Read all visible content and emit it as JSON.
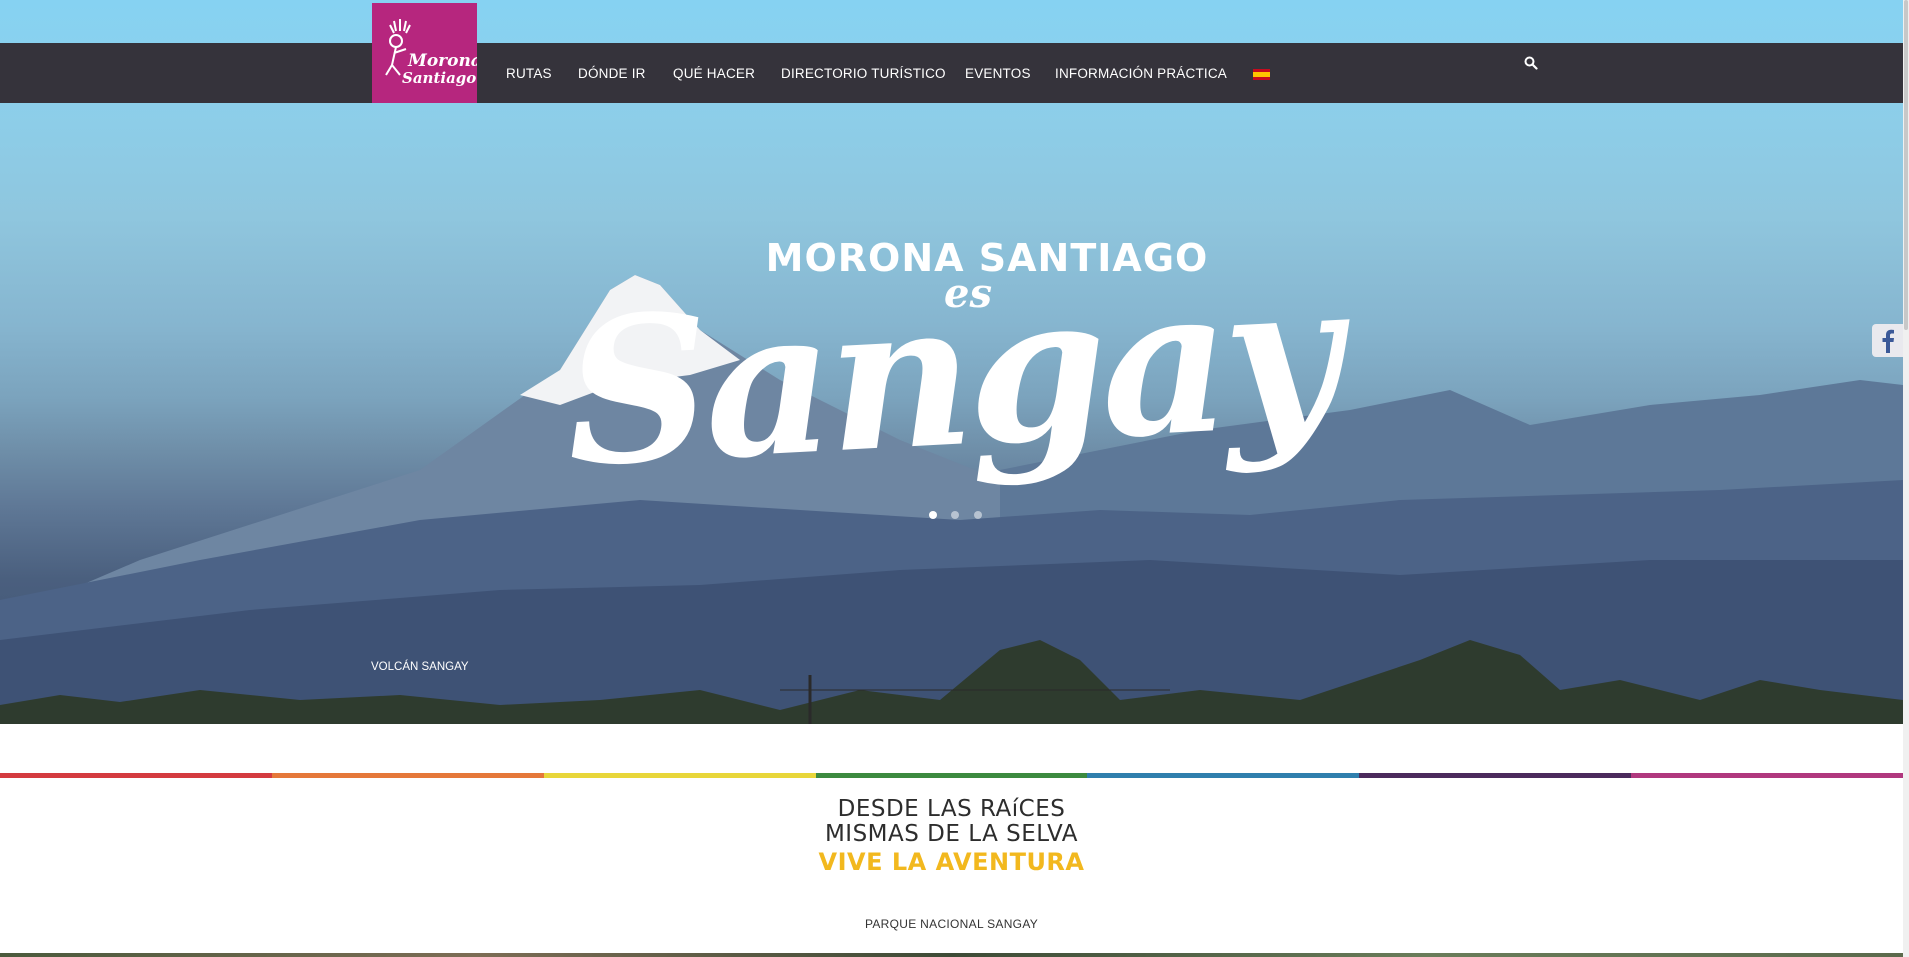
{
  "header": {
    "logo_text": "Morona Santiago",
    "nav": [
      {
        "label": "RUTAS"
      },
      {
        "label": "DÓNDE IR"
      },
      {
        "label": "QUÉ HACER"
      },
      {
        "label": "DIRECTORIO TURÍSTICO"
      },
      {
        "label": "EVENTOS"
      },
      {
        "label": "INFORMACIÓN PRÁCTICA"
      }
    ],
    "language_icon": "spain-flag-icon",
    "search_icon": "search-icon"
  },
  "hero": {
    "title": "MORONA SANTIAGO",
    "subtitle": "es",
    "script": "Sangay",
    "caption": "VOLCÁN SANGAY",
    "slides_count": 3,
    "active_slide": 1
  },
  "social": {
    "facebook_icon": "facebook-icon"
  },
  "intro": {
    "line1": "DESDE LAS RAíCES",
    "line2": "MISMAS DE LA SELVA",
    "line3": "VIVE LA AVENTURA",
    "section_label": "PARQUE NACIONAL SANGAY"
  },
  "colors": {
    "brand": "#b6267e",
    "navbar": "#35333b",
    "accent_yellow": "#f2b81e",
    "rainbow": [
      "#d43b3f",
      "#e5783a",
      "#e8d63a",
      "#3c8a3f",
      "#2f7fad",
      "#4b2a5c",
      "#b0387e"
    ]
  }
}
